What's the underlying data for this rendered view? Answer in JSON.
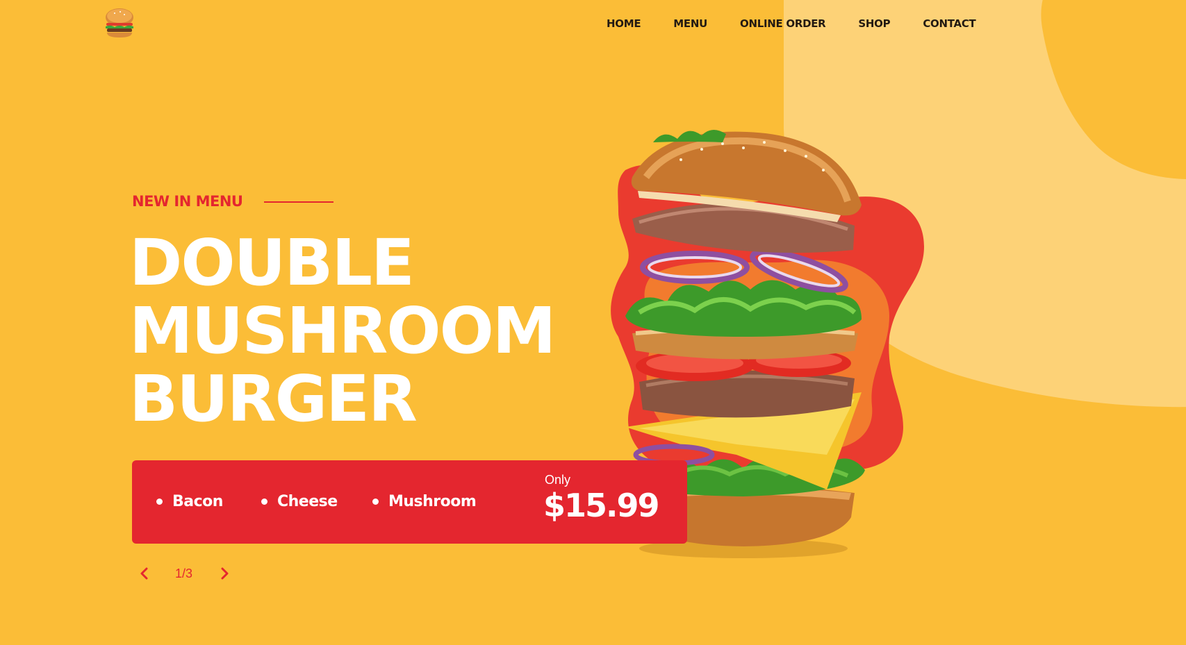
{
  "header": {
    "logo_icon": "burger-logo-icon",
    "nav": [
      {
        "label": "HOME"
      },
      {
        "label": "MENU"
      },
      {
        "label": "ONLINE ORDER"
      },
      {
        "label": "SHOP"
      },
      {
        "label": "CONTACT"
      }
    ]
  },
  "hero": {
    "kicker": "NEW IN MENU",
    "title_lines": [
      "DOUBLE",
      "MUSHROOM",
      "BURGER"
    ],
    "ingredients": [
      "Bacon",
      "Cheese",
      "Mushroom"
    ],
    "price_prefix": "Only",
    "price": "$15.99",
    "image_icon": "burger-image"
  },
  "pager": {
    "counter": "1/3",
    "prev_icon": "chevron-left-icon",
    "next_icon": "chevron-right-icon"
  },
  "colors": {
    "background": "#fbbd37",
    "accent_red": "#e4262f",
    "light_blob": "#fdd277",
    "nav_text": "#231a12"
  }
}
